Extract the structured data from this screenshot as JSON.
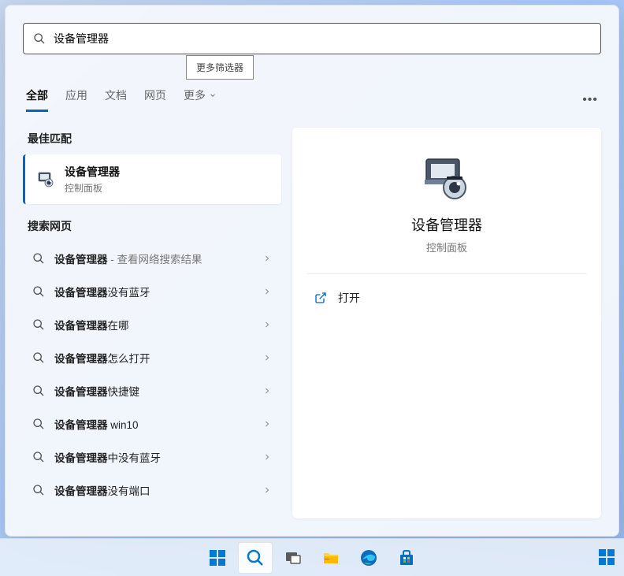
{
  "search": {
    "query": "设备管理器",
    "filters_tooltip": "更多筛选器"
  },
  "tabs": {
    "all": "全部",
    "apps": "应用",
    "docs": "文档",
    "web": "网页",
    "more": "更多"
  },
  "sections": {
    "best_match": "最佳匹配",
    "search_web": "搜索网页"
  },
  "best_match": {
    "title": "设备管理器",
    "subtitle": "控制面板"
  },
  "web_results": [
    {
      "bold": "设备管理器",
      "rest": "",
      "suffix": " - 查看网络搜索结果"
    },
    {
      "bold": "设备管理器",
      "rest": "没有蓝牙",
      "suffix": ""
    },
    {
      "bold": "设备管理器",
      "rest": "在哪",
      "suffix": ""
    },
    {
      "bold": "设备管理器",
      "rest": "怎么打开",
      "suffix": ""
    },
    {
      "bold": "设备管理器",
      "rest": "快捷键",
      "suffix": ""
    },
    {
      "bold": "设备管理器",
      "rest": " win10",
      "suffix": ""
    },
    {
      "bold": "设备管理器",
      "rest": "中没有蓝牙",
      "suffix": ""
    },
    {
      "bold": "设备管理器",
      "rest": "没有端口",
      "suffix": ""
    }
  ],
  "detail": {
    "title": "设备管理器",
    "subtitle": "控制面板",
    "open": "打开"
  }
}
